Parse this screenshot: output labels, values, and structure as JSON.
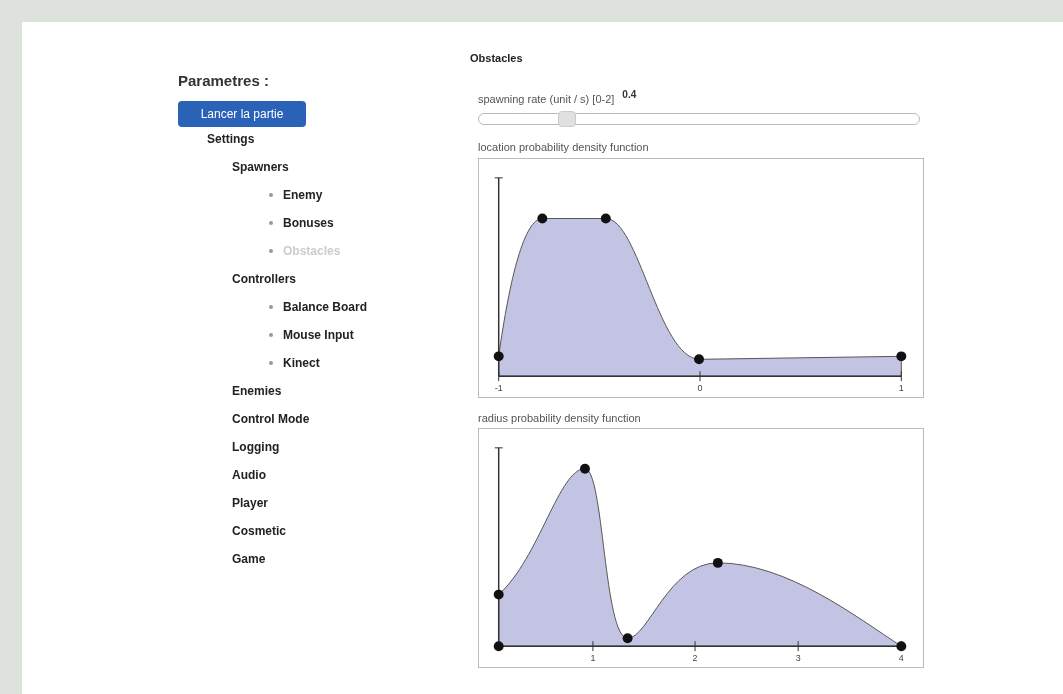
{
  "sidebar": {
    "title": "Parametres :",
    "start_button": "Lancer la partie",
    "tree": [
      {
        "label": "Settings",
        "selected": false,
        "children": [
          {
            "label": "Spawners",
            "selected": false,
            "children": [
              {
                "label": "Enemy",
                "selected": false
              },
              {
                "label": "Bonuses",
                "selected": false
              },
              {
                "label": "Obstacles",
                "selected": true
              }
            ]
          },
          {
            "label": "Controllers",
            "selected": false,
            "children": [
              {
                "label": "Balance Board",
                "selected": false
              },
              {
                "label": "Mouse Input",
                "selected": false
              },
              {
                "label": "Kinect",
                "selected": false
              }
            ]
          },
          {
            "label": "Enemies",
            "selected": false
          },
          {
            "label": "Control Mode",
            "selected": false
          },
          {
            "label": "Logging",
            "selected": false
          },
          {
            "label": "Audio",
            "selected": false
          },
          {
            "label": "Player",
            "selected": false
          },
          {
            "label": "Cosmetic",
            "selected": false
          },
          {
            "label": "Game",
            "selected": false
          }
        ]
      }
    ]
  },
  "panel": {
    "title": "Obstacles",
    "slider": {
      "label": "spawning rate (unit / s) [0-2]",
      "value": "0.4",
      "level": 0.2
    },
    "charts": [
      {
        "title": "location probability density function",
        "kind": "location",
        "x_tick_labels": [
          "-1",
          "0",
          "1"
        ]
      },
      {
        "title": "radius probability density function",
        "kind": "radius",
        "x_tick_labels": [
          "1",
          "2",
          "3",
          "4"
        ]
      }
    ]
  }
}
